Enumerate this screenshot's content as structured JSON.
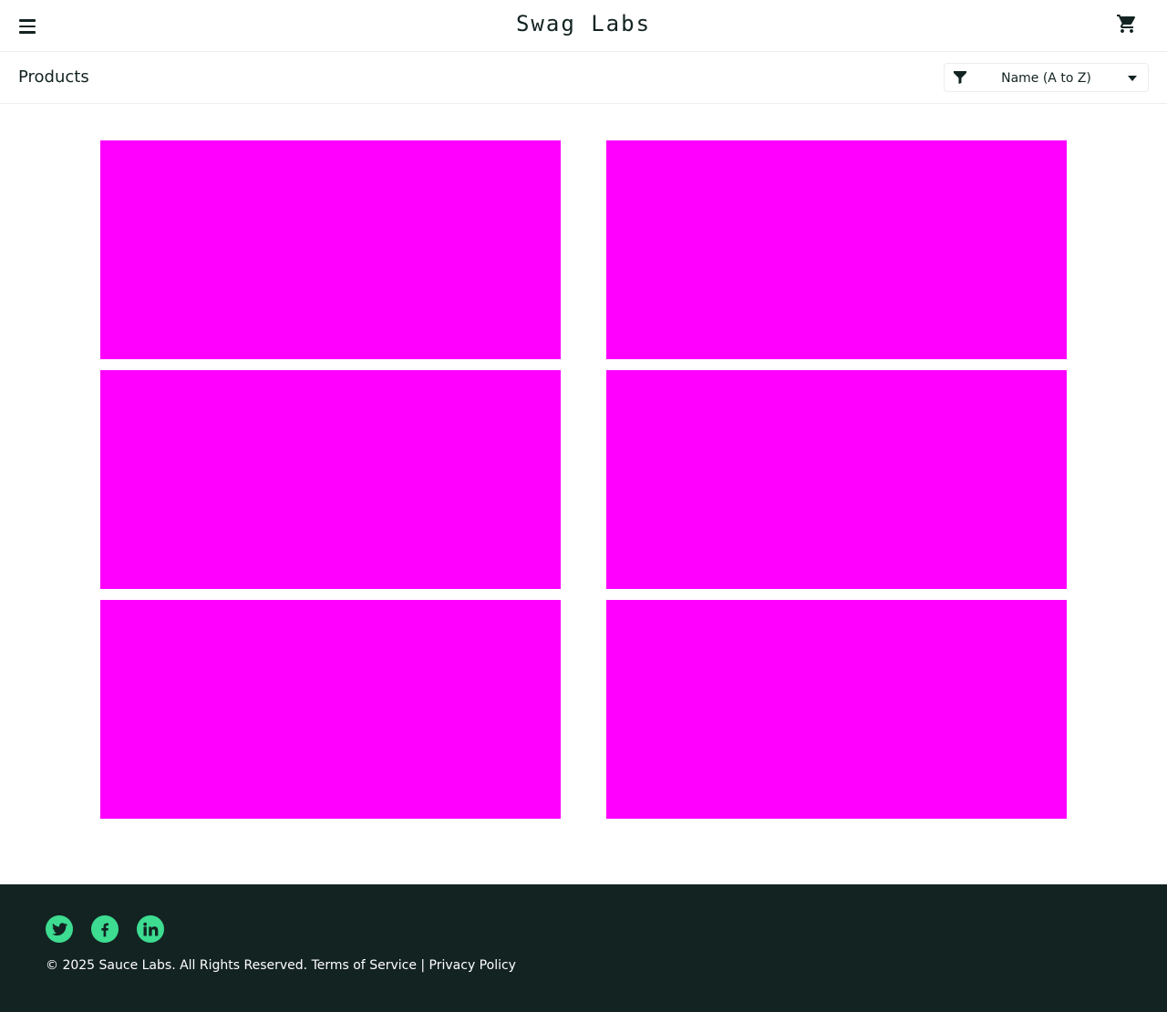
{
  "header": {
    "title": "Swag Labs",
    "menu_icon": "hamburger-menu-icon",
    "cart_icon": "shopping-cart-icon"
  },
  "subheader": {
    "title": "Products",
    "sort": {
      "selected": "Name (A to Z)",
      "icon": "filter-icon"
    }
  },
  "products": [
    {
      "image": "missing-image-placeholder"
    },
    {
      "image": "missing-image-placeholder"
    },
    {
      "image": "missing-image-placeholder"
    },
    {
      "image": "missing-image-placeholder"
    },
    {
      "image": "missing-image-placeholder"
    },
    {
      "image": "missing-image-placeholder"
    }
  ],
  "footer": {
    "social": [
      "twitter-icon",
      "facebook-icon",
      "linkedin-icon"
    ],
    "copyright": "© 2025 Sauce Labs. All Rights Reserved. Terms of Service | Privacy Policy"
  },
  "colors": {
    "placeholder": "#ff00ff",
    "footer_bg": "#132322",
    "accent": "#3ddc91",
    "text": "#132322"
  }
}
